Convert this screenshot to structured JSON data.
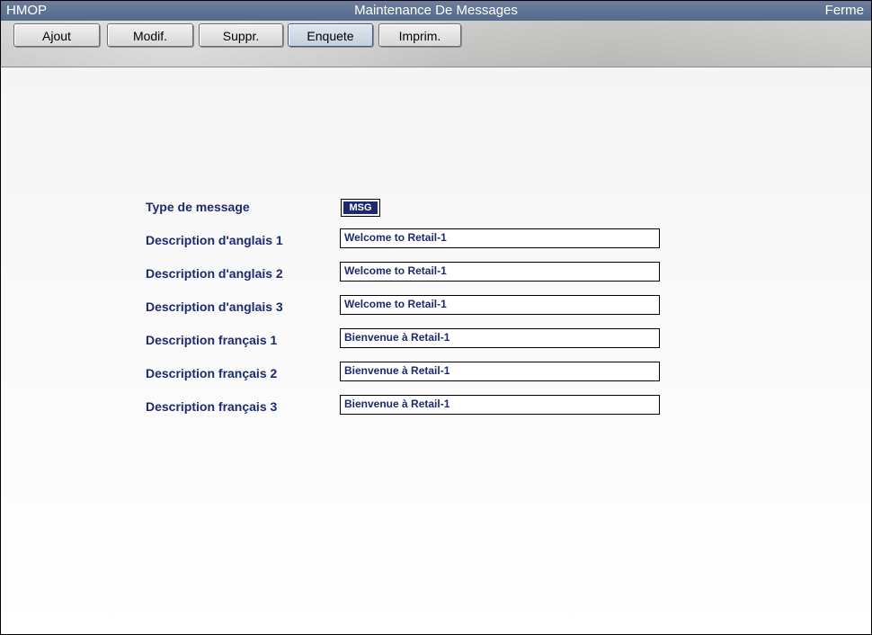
{
  "window": {
    "app_name": "HMOP",
    "title": "Maintenance De Messages",
    "close_label": "Ferme"
  },
  "toolbar": {
    "buttons": [
      {
        "label": "Ajout"
      },
      {
        "label": "Modif."
      },
      {
        "label": "Suppr."
      },
      {
        "label": "Enquete",
        "active": true
      },
      {
        "label": "Imprim."
      }
    ]
  },
  "form": {
    "type_label": "Type de message",
    "type_value": "MSG",
    "fields": [
      {
        "label": "Description d'anglais 1",
        "value": "Welcome to Retail-1"
      },
      {
        "label": "Description d'anglais 2",
        "value": "Welcome to Retail-1"
      },
      {
        "label": "Description d'anglais 3",
        "value": "Welcome to Retail-1"
      },
      {
        "label": "Description français 1",
        "value": "Bienvenue à Retail-1"
      },
      {
        "label": "Description français 2",
        "value": "Bienvenue à Retail-1"
      },
      {
        "label": "Description français 3",
        "value": "Bienvenue à Retail-1"
      }
    ]
  },
  "colors": {
    "titlebar": "#5e7193",
    "label_text": "#1d2a6e",
    "selection": "#1d2a6e"
  }
}
